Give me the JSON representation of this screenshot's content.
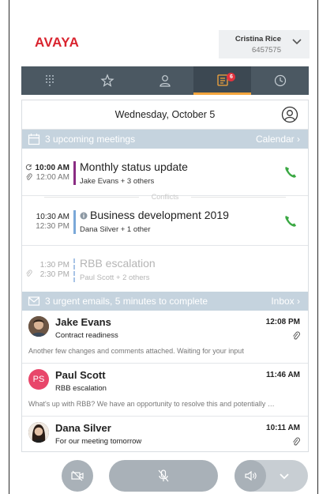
{
  "brand": {
    "logo": "AVAYA",
    "logo_color": "#d9232e"
  },
  "user": {
    "name": "Cristina Rice",
    "extension": "6457575"
  },
  "tabs": [
    {
      "name": "dialpad-icon",
      "active": false
    },
    {
      "name": "star-icon",
      "active": false
    },
    {
      "name": "contact-icon",
      "active": false
    },
    {
      "name": "calendar-clipboard-icon",
      "active": true,
      "badge": "6"
    },
    {
      "name": "clock-icon",
      "active": false
    }
  ],
  "date_header": "Wednesday, October 5",
  "meetings_section": {
    "label": "3 upcoming meetings",
    "link": "Calendar ›"
  },
  "meetings": [
    {
      "start": "10:00 AM",
      "end": "12:00 AM",
      "title": "Monthly status update",
      "attendees": "Jake Evans + 3 others",
      "bar_color": "#8a2c83"
    },
    {
      "start": "10:30 AM",
      "end": "12:30 PM",
      "title": "Business development 2019",
      "attendees": "Dana Silver + 1 other",
      "bar_color": "#7aa8d8"
    },
    {
      "start": "1:30 PM",
      "end": "2:30 PM",
      "title": "RBB escalation",
      "attendees": "Paul Scott + 2 others",
      "bar_color": "#a9c4e6"
    }
  ],
  "conflicts_label": "Conflicts",
  "emails_section": {
    "label": "3 urgent emails, 5 minutes to complete",
    "link": "Inbox ›"
  },
  "emails": [
    {
      "name": "Jake Evans",
      "subject": "Contract readiness",
      "time": "12:08 PM",
      "preview": "Another few changes and comments attached. Waiting for your input",
      "attachment": true
    },
    {
      "name": "Paul Scott",
      "initials": "PS",
      "subject": "RBB escalation",
      "time": "11:46 AM",
      "preview": "What's up with RBB? We have an opportunity to resolve this and potentially …",
      "attachment": false
    },
    {
      "name": "Dana Silver",
      "subject": "For our meeting tomorrow",
      "time": "10:11 AM",
      "preview": "",
      "attachment": true
    }
  ],
  "controls": [
    "video-off-icon",
    "mute-microphone-icon",
    "speaker-icon",
    "chevron-down-icon"
  ],
  "colors": {
    "tabbar": "#4b5862",
    "accent": "#f3a53d",
    "call_green": "#3aa843",
    "section_bg": "#c5d3de",
    "control_bg": "#a9b1b8"
  }
}
